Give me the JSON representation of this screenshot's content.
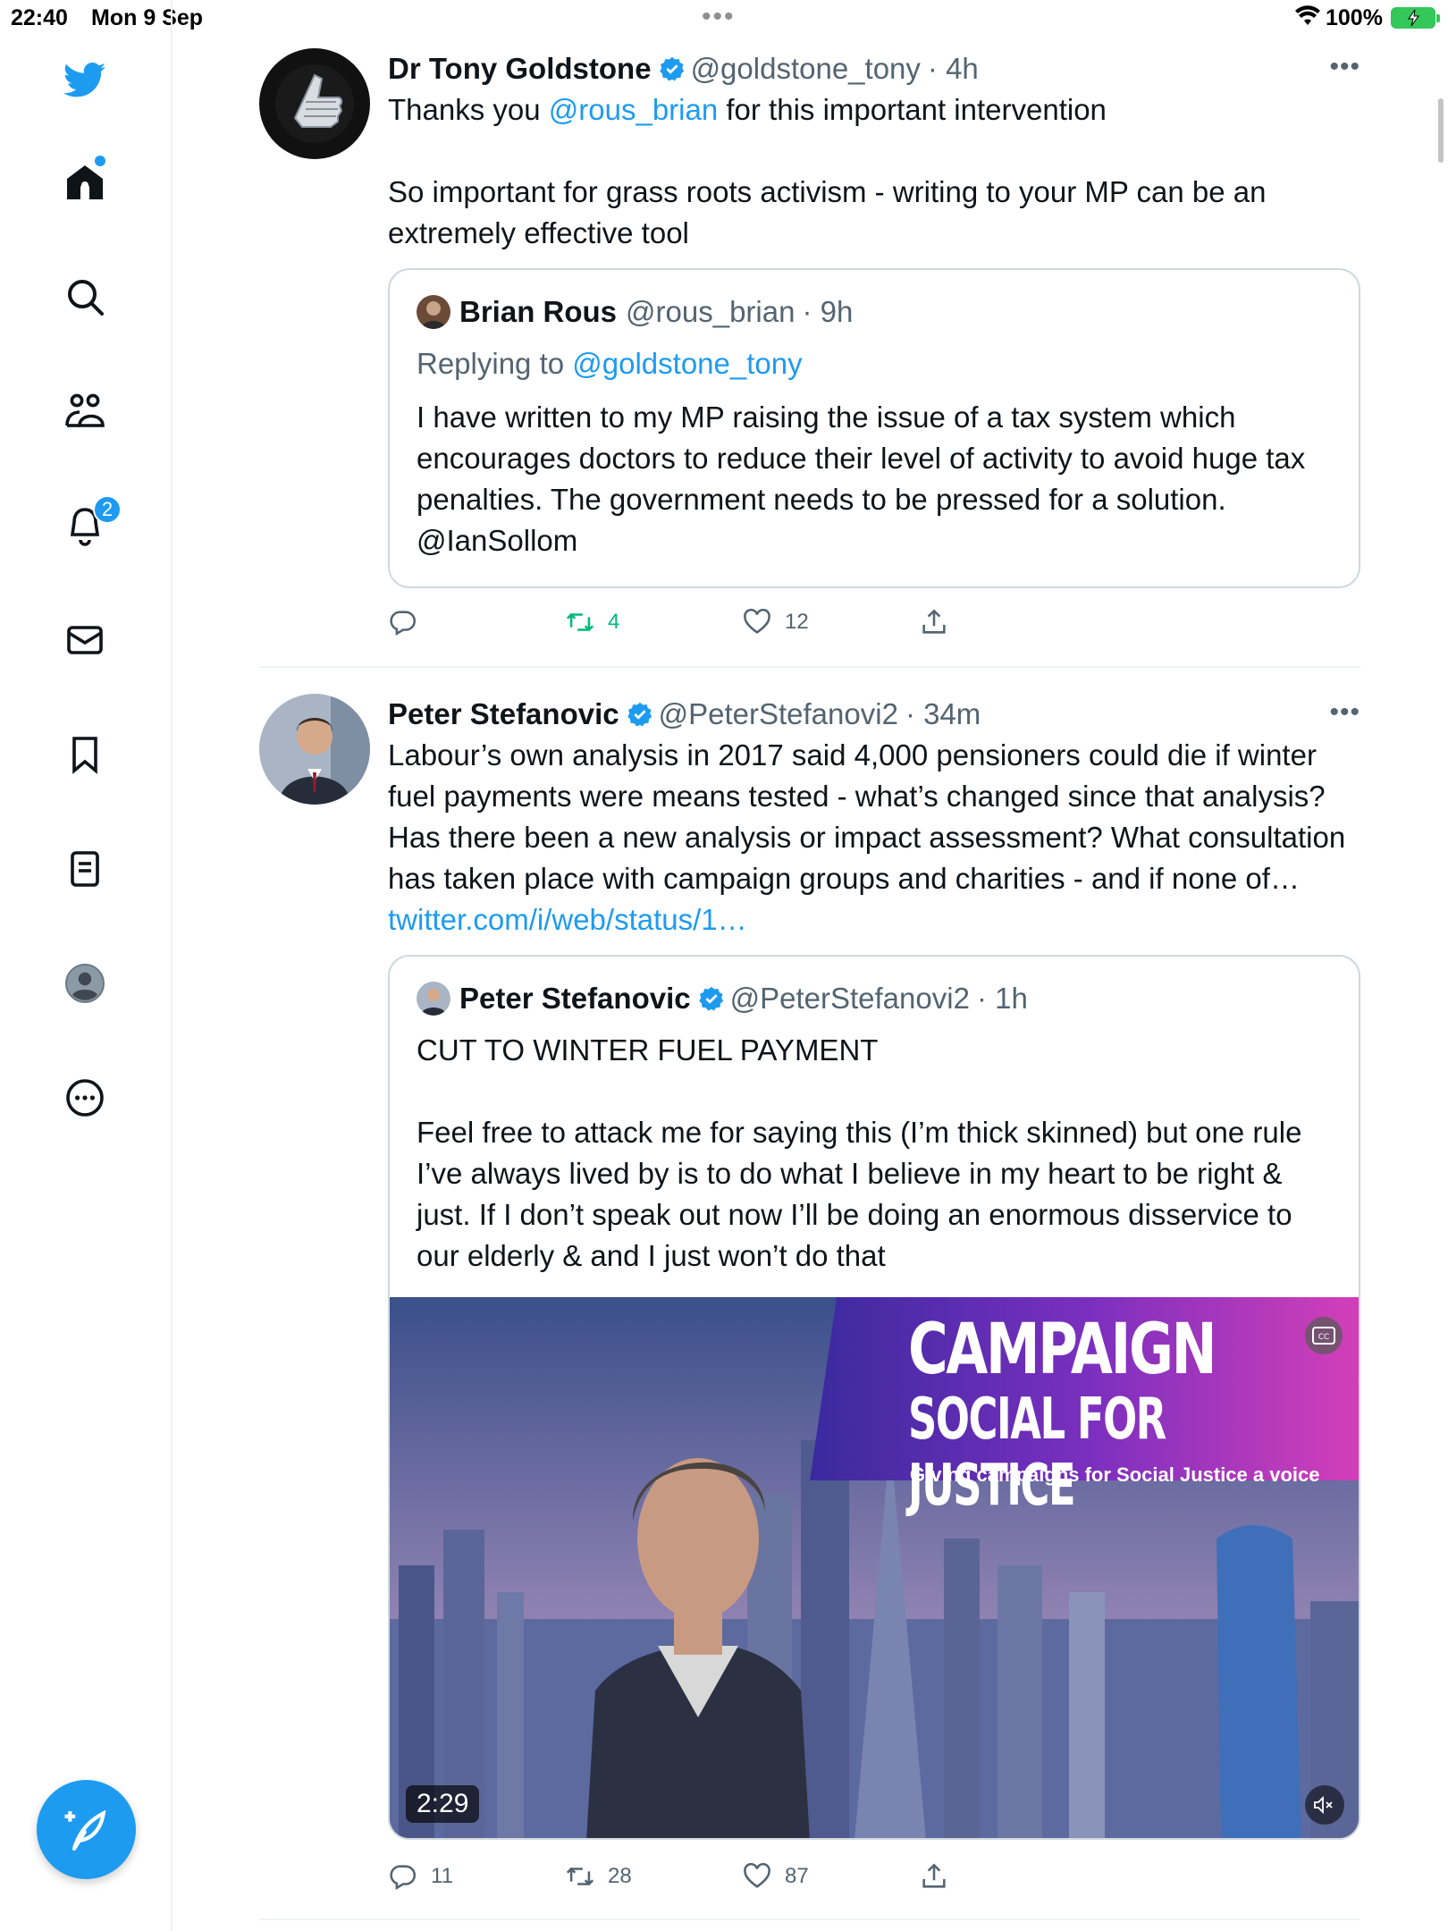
{
  "status_bar": {
    "time": "22:40",
    "date": "Mon 9 Sep",
    "battery": "100%"
  },
  "sidebar": {
    "items": [
      {
        "icon": "twitter-logo-icon"
      },
      {
        "icon": "home-icon"
      },
      {
        "icon": "search-icon"
      },
      {
        "icon": "communities-icon"
      },
      {
        "icon": "notifications-icon"
      },
      {
        "icon": "messages-icon"
      },
      {
        "icon": "bookmarks-icon"
      },
      {
        "icon": "lists-icon"
      },
      {
        "icon": "profile-icon"
      },
      {
        "icon": "more-icon"
      }
    ],
    "notifications_badge": "2",
    "compose_icon": "compose-tweet-icon"
  },
  "tweets": [
    {
      "name": "Dr Tony Goldstone",
      "handle": "@goldstone_tony",
      "time": "· 4h",
      "text_prefix": "Thanks you ",
      "mention": "@rous_brian",
      "text_suffix": " for this important intervention\n\nSo important for grass roots activism - writing to your MP can be an extremely effective tool",
      "quote": {
        "name": "Brian Rous",
        "handle": "@rous_brian",
        "time": "· 9h",
        "replying_label": "Replying to ",
        "replying_to": "@goldstone_tony",
        "text": "I have written to my MP raising the issue of a tax system which encourages doctors to reduce their level of activity to avoid huge tax penalties. The government needs to be pressed for a solution. @IanSollom"
      },
      "stats": {
        "replies": "",
        "retweets": "4",
        "likes": "12"
      }
    },
    {
      "name": "Peter Stefanovic",
      "handle": "@PeterStefanovi2",
      "time": "· 34m",
      "text": "Labour’s own analysis in 2017 said 4,000 pensioners could die if winter fuel payments were means tested - what’s changed since that analysis? Has there been a new analysis or impact assessment? What consultation has taken place with campaign groups and charities - and if none of… ",
      "link": "twitter.com/i/web/status/1…",
      "quote": {
        "name": "Peter Stefanovic",
        "handle": "@PeterStefanovi2",
        "time": "· 1h",
        "text": "CUT TO WINTER FUEL PAYMENT\n\nFeel free to attack me for saying this (I’m thick skinned) but one rule I’ve always lived by is to do what I believe in my heart to be right & just. If I don’t speak out now I’ll be doing an enormous disservice to our elderly & and I just won’t do that",
        "video": {
          "duration": "2:29",
          "banner_line1": "CAMPAIGN",
          "banner_line2": "SOCIAL FOR JUSTICE",
          "banner_tagline": "Giving campaigns for Social Justice a voice"
        }
      },
      "stats": {
        "replies": "11",
        "retweets": "28",
        "likes": "87"
      }
    }
  ],
  "colors": {
    "accent": "#1d9bf0",
    "retweet": "#00ba7c",
    "muted": "#536471"
  }
}
